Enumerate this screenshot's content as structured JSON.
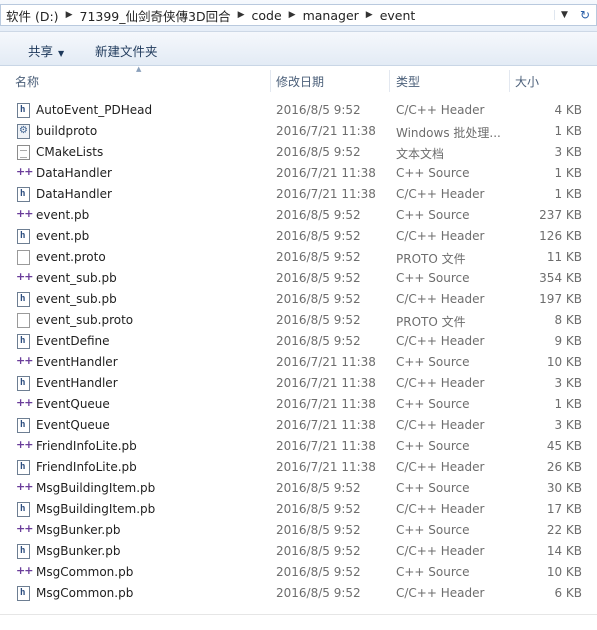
{
  "address": {
    "segments": [
      "软件 (D:)",
      "71399_仙剑奇侠傳3D回合",
      "code",
      "manager",
      "event"
    ]
  },
  "toolbar": {
    "share_label": "共享",
    "new_folder_label": "新建文件夹"
  },
  "columns": {
    "name": "名称",
    "date": "修改日期",
    "type": "类型",
    "size": "大小"
  },
  "files": [
    {
      "name": "AutoEvent_PDHead",
      "date": "2016/8/5 9:52",
      "type": "C/C++ Header",
      "size": "4 KB",
      "icon": "header-file-icon"
    },
    {
      "name": "buildproto",
      "date": "2016/7/21 11:38",
      "type": "Windows 批处理...",
      "size": "1 KB",
      "icon": "batch-file-icon"
    },
    {
      "name": "CMakeLists",
      "date": "2016/8/5 9:52",
      "type": "文本文档",
      "size": "3 KB",
      "icon": "text-file-icon"
    },
    {
      "name": "DataHandler",
      "date": "2016/7/21 11:38",
      "type": "C++ Source",
      "size": "1 KB",
      "icon": "source-file-icon"
    },
    {
      "name": "DataHandler",
      "date": "2016/7/21 11:38",
      "type": "C/C++ Header",
      "size": "1 KB",
      "icon": "header-file-icon"
    },
    {
      "name": "event.pb",
      "date": "2016/8/5 9:52",
      "type": "C++ Source",
      "size": "237 KB",
      "icon": "source-file-icon"
    },
    {
      "name": "event.pb",
      "date": "2016/8/5 9:52",
      "type": "C/C++ Header",
      "size": "126 KB",
      "icon": "header-file-icon"
    },
    {
      "name": "event.proto",
      "date": "2016/8/5 9:52",
      "type": "PROTO 文件",
      "size": "11 KB",
      "icon": "blank-file-icon"
    },
    {
      "name": "event_sub.pb",
      "date": "2016/8/5 9:52",
      "type": "C++ Source",
      "size": "354 KB",
      "icon": "source-file-icon"
    },
    {
      "name": "event_sub.pb",
      "date": "2016/8/5 9:52",
      "type": "C/C++ Header",
      "size": "197 KB",
      "icon": "header-file-icon"
    },
    {
      "name": "event_sub.proto",
      "date": "2016/8/5 9:52",
      "type": "PROTO 文件",
      "size": "8 KB",
      "icon": "blank-file-icon"
    },
    {
      "name": "EventDefine",
      "date": "2016/8/5 9:52",
      "type": "C/C++ Header",
      "size": "9 KB",
      "icon": "header-file-icon"
    },
    {
      "name": "EventHandler",
      "date": "2016/7/21 11:38",
      "type": "C++ Source",
      "size": "10 KB",
      "icon": "source-file-icon"
    },
    {
      "name": "EventHandler",
      "date": "2016/7/21 11:38",
      "type": "C/C++ Header",
      "size": "3 KB",
      "icon": "header-file-icon"
    },
    {
      "name": "EventQueue",
      "date": "2016/7/21 11:38",
      "type": "C++ Source",
      "size": "1 KB",
      "icon": "source-file-icon"
    },
    {
      "name": "EventQueue",
      "date": "2016/7/21 11:38",
      "type": "C/C++ Header",
      "size": "3 KB",
      "icon": "header-file-icon"
    },
    {
      "name": "FriendInfoLite.pb",
      "date": "2016/7/21 11:38",
      "type": "C++ Source",
      "size": "45 KB",
      "icon": "source-file-icon"
    },
    {
      "name": "FriendInfoLite.pb",
      "date": "2016/7/21 11:38",
      "type": "C/C++ Header",
      "size": "26 KB",
      "icon": "header-file-icon"
    },
    {
      "name": "MsgBuildingItem.pb",
      "date": "2016/8/5 9:52",
      "type": "C++ Source",
      "size": "30 KB",
      "icon": "source-file-icon"
    },
    {
      "name": "MsgBuildingItem.pb",
      "date": "2016/8/5 9:52",
      "type": "C/C++ Header",
      "size": "17 KB",
      "icon": "header-file-icon"
    },
    {
      "name": "MsgBunker.pb",
      "date": "2016/8/5 9:52",
      "type": "C++ Source",
      "size": "22 KB",
      "icon": "source-file-icon"
    },
    {
      "name": "MsgBunker.pb",
      "date": "2016/8/5 9:52",
      "type": "C/C++ Header",
      "size": "14 KB",
      "icon": "header-file-icon"
    },
    {
      "name": "MsgCommon.pb",
      "date": "2016/8/5 9:52",
      "type": "C++ Source",
      "size": "10 KB",
      "icon": "source-file-icon"
    },
    {
      "name": "MsgCommon.pb",
      "date": "2016/8/5 9:52",
      "type": "C/C++ Header",
      "size": "6 KB",
      "icon": "header-file-icon"
    }
  ]
}
